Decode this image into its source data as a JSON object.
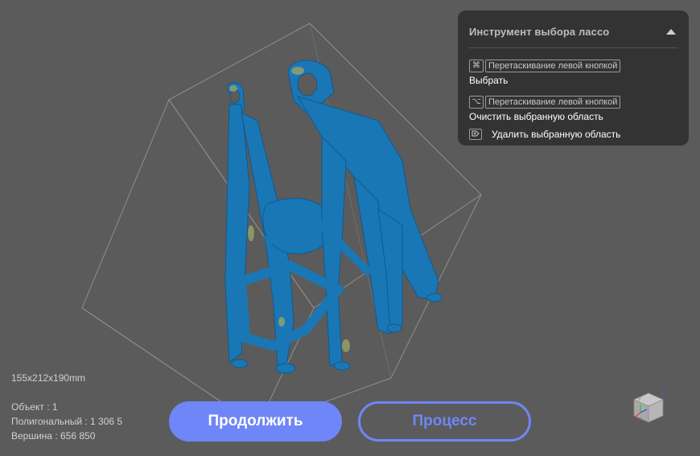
{
  "panel": {
    "title": "Инструмент выбора лассо",
    "select": {
      "modifier_symbol": "⌘",
      "drag_label": "Перетаскивание левой кнопкой",
      "action": "Выбрать"
    },
    "clear": {
      "modifier_symbol": "⌥",
      "drag_label": "Перетаскивание левой кнопкой",
      "action": "Очистить выбранную область"
    },
    "delete": {
      "action": "Удалить выбранную область"
    }
  },
  "info": {
    "dimensions": "155x212x190mm",
    "object": "Объект : 1",
    "polygons": "Полигональный : 1 306 5",
    "vertices": "Вершина : 656 850"
  },
  "buttons": {
    "continue": "Продолжить",
    "process": "Процесс"
  },
  "view_cube": {
    "axes": [
      "y",
      "z",
      "x"
    ]
  },
  "colors": {
    "accent": "#6e86f7",
    "model": "#1a77b6",
    "background": "#5b5b5b"
  },
  "icons": {
    "collapse": "triangle-up-icon",
    "delete": "delete-key-icon"
  }
}
